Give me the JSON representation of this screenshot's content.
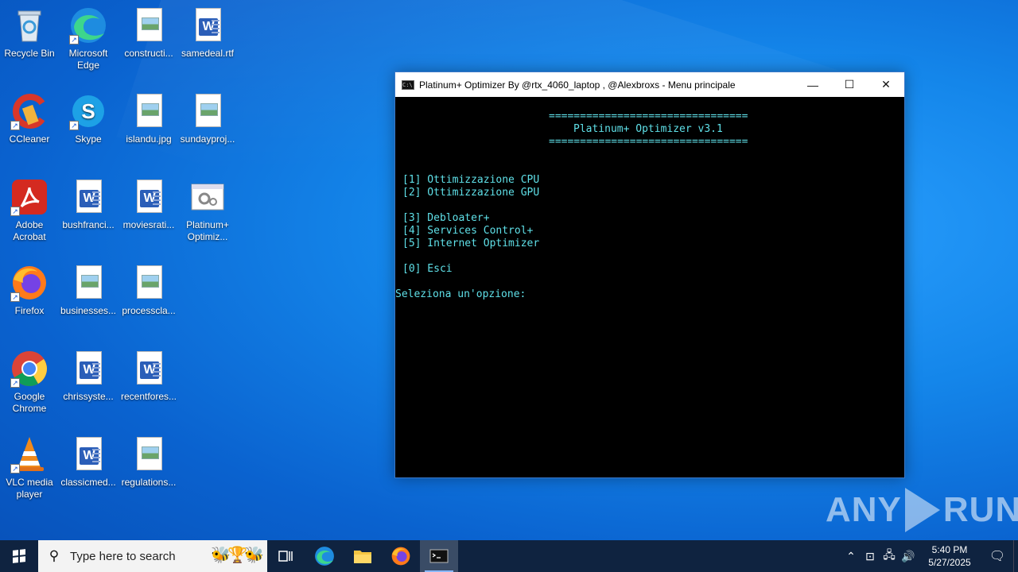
{
  "desktop": {
    "icons": [
      {
        "label": "Recycle Bin",
        "icon": "recycle-bin-icon"
      },
      {
        "label": "Microsoft Edge",
        "icon": "edge-icon"
      },
      {
        "label": "constructi...",
        "icon": "image-file-icon"
      },
      {
        "label": "samedeal.rtf",
        "icon": "word-file-icon"
      },
      {
        "label": "CCleaner",
        "icon": "ccleaner-icon"
      },
      {
        "label": "Skype",
        "icon": "skype-icon"
      },
      {
        "label": "islandu.jpg",
        "icon": "image-file-icon"
      },
      {
        "label": "sundayproj...",
        "icon": "image-file-icon"
      },
      {
        "label": "Adobe Acrobat",
        "icon": "acrobat-icon"
      },
      {
        "label": "bushfranci...",
        "icon": "word-file-icon"
      },
      {
        "label": "moviesrati...",
        "icon": "word-file-icon"
      },
      {
        "label": "Platinum+ Optimiz...",
        "icon": "batch-file-icon"
      },
      {
        "label": "Firefox",
        "icon": "firefox-icon"
      },
      {
        "label": "businesses...",
        "icon": "image-file-icon"
      },
      {
        "label": "processcla...",
        "icon": "image-file-icon"
      },
      {
        "label": "Google Chrome",
        "icon": "chrome-icon"
      },
      {
        "label": "chrissyste...",
        "icon": "word-file-icon"
      },
      {
        "label": "recentfores...",
        "icon": "word-file-icon"
      },
      {
        "label": "VLC media player",
        "icon": "vlc-icon"
      },
      {
        "label": "classicmed...",
        "icon": "word-file-icon"
      },
      {
        "label": "regulations...",
        "icon": "image-file-icon"
      }
    ]
  },
  "console": {
    "title": "Platinum+ Optimizer By @rtx_4060_laptop , @Alexbroxs - Menu principale",
    "lines": [
      "================================",
      "Platinum+ Optimizer v3.1",
      "================================",
      "[1] Ottimizzazione CPU",
      "[2] Ottimizzazione GPU",
      "[3] Debloater+",
      "[4] Services Control+",
      "[5] Internet Optimizer",
      "[0] Esci",
      "Seleziona un'opzione:"
    ],
    "text_color": "#5fe0e8"
  },
  "watermark": {
    "text_left": "ANY",
    "text_right": "RUN"
  },
  "taskbar": {
    "search_placeholder": "Type here to search",
    "time": "5:40 PM",
    "date": "5/27/2025",
    "apps": [
      "task-view-icon",
      "edge-icon",
      "file-explorer-icon",
      "firefox-icon",
      "cmd-icon"
    ]
  }
}
